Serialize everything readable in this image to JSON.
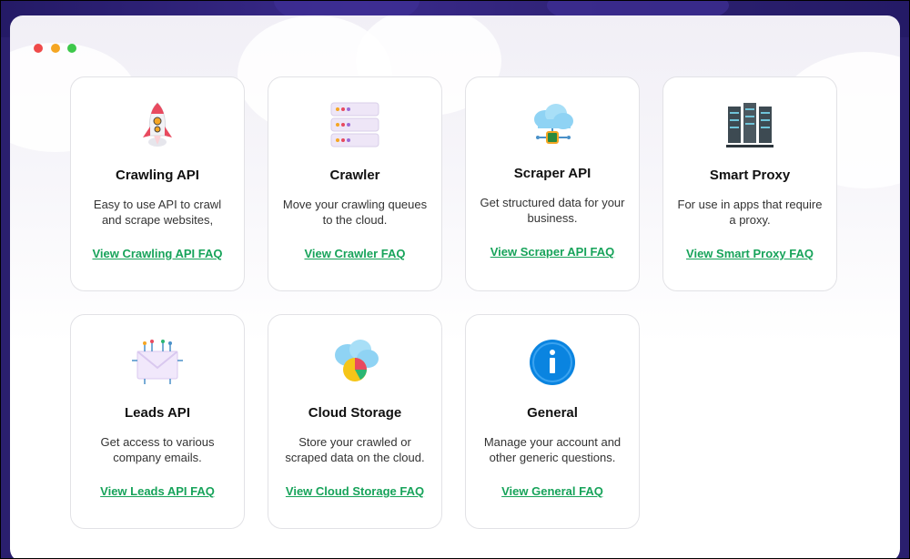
{
  "window": {
    "traffic_lights": [
      "#ef4a4a",
      "#f5a623",
      "#3ec84b"
    ]
  },
  "cards": [
    {
      "title": "Crawling API",
      "desc": "Easy to use API to crawl and scrape websites,",
      "link": "View Crawling API FAQ",
      "icon": "rocket-icon"
    },
    {
      "title": "Crawler",
      "desc": "Move your crawling queues to the cloud.",
      "link": "View Crawler FAQ",
      "icon": "server-stack-icon"
    },
    {
      "title": "Scraper API",
      "desc": "Get structured data for your business.",
      "link": "View Scraper API FAQ",
      "icon": "cloud-chip-icon"
    },
    {
      "title": "Smart Proxy",
      "desc": "For use in apps that require a proxy.",
      "link": "View Smart Proxy FAQ",
      "icon": "server-rack-icon"
    },
    {
      "title": "Leads API",
      "desc": "Get access to various company emails.",
      "link": "View Leads API FAQ",
      "icon": "envelope-network-icon"
    },
    {
      "title": "Cloud Storage",
      "desc": "Store your crawled or scraped data on the cloud.",
      "link": "View Cloud Storage FAQ",
      "icon": "cloud-pie-icon"
    },
    {
      "title": "General",
      "desc": "Manage your account and other generic questions.",
      "link": "View General FAQ",
      "icon": "info-icon"
    }
  ],
  "colors": {
    "link": "#17a35a",
    "header_bg": "#2a1f6e"
  }
}
